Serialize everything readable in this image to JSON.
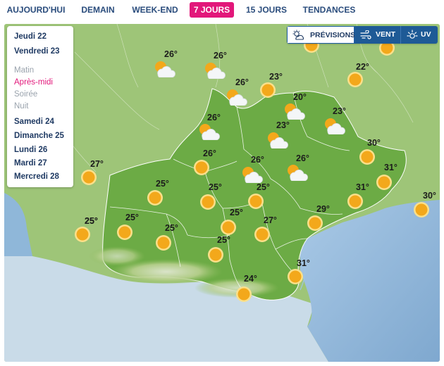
{
  "tabs": [
    {
      "label": "AUJOURD'HUI",
      "active": false
    },
    {
      "label": "DEMAIN",
      "active": false
    },
    {
      "label": "WEEK-END",
      "active": false
    },
    {
      "label": "7 JOURS",
      "active": true
    },
    {
      "label": "15 JOURS",
      "active": false
    },
    {
      "label": "TENDANCES",
      "active": false
    }
  ],
  "days_top": [
    "Jeudi 22",
    "Vendredi 23"
  ],
  "periods": [
    {
      "label": "Matin",
      "active": false
    },
    {
      "label": "Après-midi",
      "active": true
    },
    {
      "label": "Soirée",
      "active": false
    },
    {
      "label": "Nuit",
      "active": false
    }
  ],
  "days_bottom": [
    "Samedi 24",
    "Dimanche 25",
    "Lundi 26",
    "Mardi 27",
    "Mercredi 28"
  ],
  "layers": [
    {
      "label": "PRÉVISIONS",
      "icon": "sun-cloud-icon",
      "active": true
    },
    {
      "label": "VENT",
      "icon": "wind-icon",
      "active": false
    },
    {
      "label": "UV",
      "icon": "uv-sun-icon",
      "active": false
    }
  ],
  "colors": {
    "accent": "#e2177a",
    "navy": "#1f3a63",
    "region_green": "#6cab45",
    "sea": "#8ab4d6"
  },
  "markers": [
    {
      "temp": "26°",
      "icon": "partly-cloudy-icon"
    },
    {
      "temp": "26°",
      "icon": "partly-cloudy-icon"
    },
    {
      "temp": "26°",
      "icon": "partly-cloudy-icon"
    },
    {
      "temp": "23°",
      "icon": "sun-icon"
    },
    {
      "temp": "22°",
      "icon": "sun-icon"
    },
    {
      "temp": "20°",
      "icon": "partly-cloudy-icon"
    },
    {
      "temp": "23°",
      "icon": "partly-cloudy-icon"
    },
    {
      "temp": "26°",
      "icon": "partly-cloudy-icon"
    },
    {
      "temp": "23°",
      "icon": "partly-cloudy-icon"
    },
    {
      "temp": "26°",
      "icon": "sun-icon"
    },
    {
      "temp": "26°",
      "icon": "partly-cloudy-icon"
    },
    {
      "temp": "26°",
      "icon": "partly-cloudy-icon"
    },
    {
      "temp": "30°",
      "icon": "sun-icon"
    },
    {
      "temp": "27°",
      "icon": "sun-icon"
    },
    {
      "temp": "31°",
      "icon": "sun-icon"
    },
    {
      "temp": "25°",
      "icon": "sun-icon"
    },
    {
      "temp": "25°",
      "icon": "sun-icon"
    },
    {
      "temp": "25°",
      "icon": "sun-icon"
    },
    {
      "temp": "31°",
      "icon": "sun-icon"
    },
    {
      "temp": "30°",
      "icon": "sun-icon"
    },
    {
      "temp": "25°",
      "icon": "sun-icon"
    },
    {
      "temp": "25°",
      "icon": "sun-icon"
    },
    {
      "temp": "25°",
      "icon": "sun-icon"
    },
    {
      "temp": "25°",
      "icon": "sun-icon"
    },
    {
      "temp": "29°",
      "icon": "sun-icon"
    },
    {
      "temp": "27°",
      "icon": "sun-icon"
    },
    {
      "temp": "25°",
      "icon": "sun-icon"
    },
    {
      "temp": "25°",
      "icon": "sun-icon"
    },
    {
      "temp": "31°",
      "icon": "sun-icon"
    },
    {
      "temp": "24°",
      "icon": "sun-icon"
    }
  ]
}
